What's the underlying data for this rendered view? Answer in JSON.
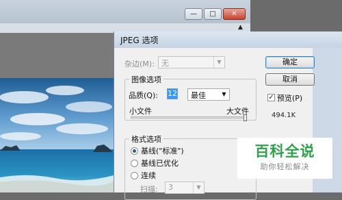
{
  "window": {
    "minimize_glyph": "—",
    "maximize_glyph": "□",
    "close_glyph": "✕",
    "scroll_arrow": "▲"
  },
  "dialog": {
    "title": "JPEG 选项",
    "matte_label": "杂边(M):",
    "matte_value": "无",
    "image_options": {
      "title": "图像选项",
      "quality_label": "品质(Q):",
      "quality_value": "12",
      "quality_preset": "最佳",
      "small_file_label": "小文件",
      "large_file_label": "大文件",
      "quality_level": 1.0
    },
    "buttons": {
      "ok": "确定",
      "cancel": "取消"
    },
    "preview": {
      "label": "预览(P)",
      "checked": true,
      "file_size": "494.1K"
    },
    "format_options": {
      "title": "格式选项",
      "baseline_standard": "基线(\"标准\")",
      "baseline_optimized": "基线已优化",
      "progressive": "连续",
      "scans_label": "扫描:",
      "scans_value": "3",
      "selected": "baseline_standard"
    }
  },
  "watermark": {
    "brand": "百科全说",
    "slogan": "助你轻松解决"
  },
  "colors": {
    "accent": "#3399ff",
    "watermark_green": "#2ea24a",
    "dialog_bg": "#f0f0f0"
  }
}
